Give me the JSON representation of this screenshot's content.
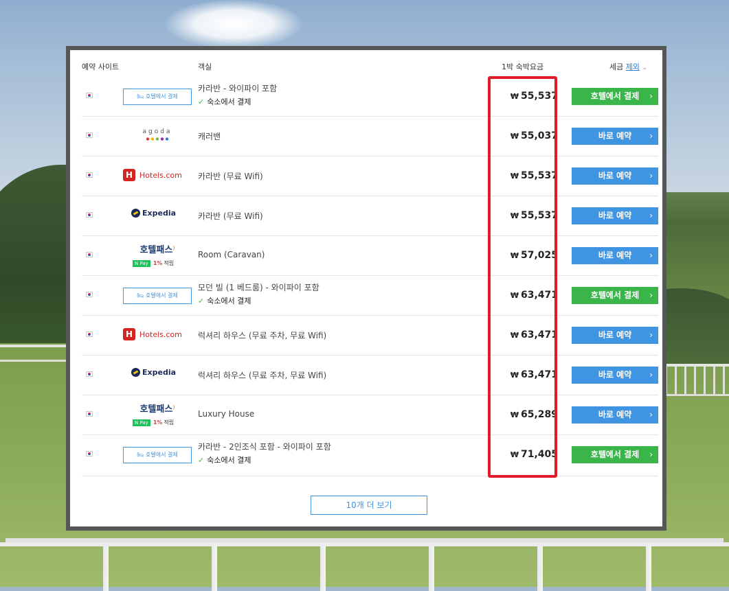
{
  "header": {
    "col_site": "예약 사이트",
    "col_room": "객실",
    "col_price": "1박 숙박요금",
    "tax_prefix": "세금",
    "tax_link": "제외",
    "tax_caret": "⌄"
  },
  "rows": [
    {
      "site_type": "hotel-pay",
      "site_label": "호텔에서 결제",
      "room": "카라반 - 와이파이 포함",
      "sub": "숙소에서 결제",
      "price": "55,537",
      "button": "호텔에서 결제",
      "button_style": "green"
    },
    {
      "site_type": "agoda",
      "site_label": "agoda",
      "room": "캐러밴",
      "sub": "",
      "price": "55,037",
      "button": "바로 예약",
      "button_style": "blue"
    },
    {
      "site_type": "hotels",
      "site_label": "Hotels.com",
      "room": "카라반 (무료 Wifi)",
      "sub": "",
      "price": "55,537",
      "button": "바로 예약",
      "button_style": "blue"
    },
    {
      "site_type": "expedia",
      "site_label": "Expedia",
      "room": "카라반 (무료 Wifi)",
      "sub": "",
      "price": "55,537",
      "button": "바로 예약",
      "button_style": "blue"
    },
    {
      "site_type": "hotelpass",
      "site_label": "호텔패스",
      "npay": "Pay",
      "npay_rate": "1%",
      "npay_text": "적립",
      "room": "Room (Caravan)",
      "sub": "",
      "price": "57,025",
      "button": "바로 예약",
      "button_style": "blue"
    },
    {
      "site_type": "hotel-pay",
      "site_label": "호텔에서 결제",
      "room": "모던 빌 (1 베드룸) - 와이파이 포함",
      "sub": "숙소에서 결제",
      "price": "63,471",
      "button": "호텔에서 결제",
      "button_style": "green"
    },
    {
      "site_type": "hotels",
      "site_label": "Hotels.com",
      "room": "럭셔리 하우스 (무료 주차, 무료 Wifi)",
      "sub": "",
      "price": "63,471",
      "button": "바로 예약",
      "button_style": "blue"
    },
    {
      "site_type": "expedia",
      "site_label": "Expedia",
      "room": "럭셔리 하우스 (무료 주차, 무료 Wifi)",
      "sub": "",
      "price": "63,471",
      "button": "바로 예약",
      "button_style": "blue"
    },
    {
      "site_type": "hotelpass",
      "site_label": "호텔패스",
      "npay": "Pay",
      "npay_rate": "1%",
      "npay_text": "적립",
      "room": "Luxury House",
      "sub": "",
      "price": "65,289",
      "button": "바로 예약",
      "button_style": "blue"
    },
    {
      "site_type": "hotel-pay",
      "site_label": "호텔에서 결제",
      "room": "카라반 - 2인조식 포함 - 와이파이 포함",
      "sub": "숙소에서 결제",
      "price": "71,405",
      "button": "호텔에서 결제",
      "button_style": "green"
    }
  ],
  "currency_symbol": "₩",
  "more_button": "10개 더 보기",
  "colors": {
    "green": "#39b54a",
    "blue": "#3f95e2",
    "highlight": "#e21b2b"
  }
}
